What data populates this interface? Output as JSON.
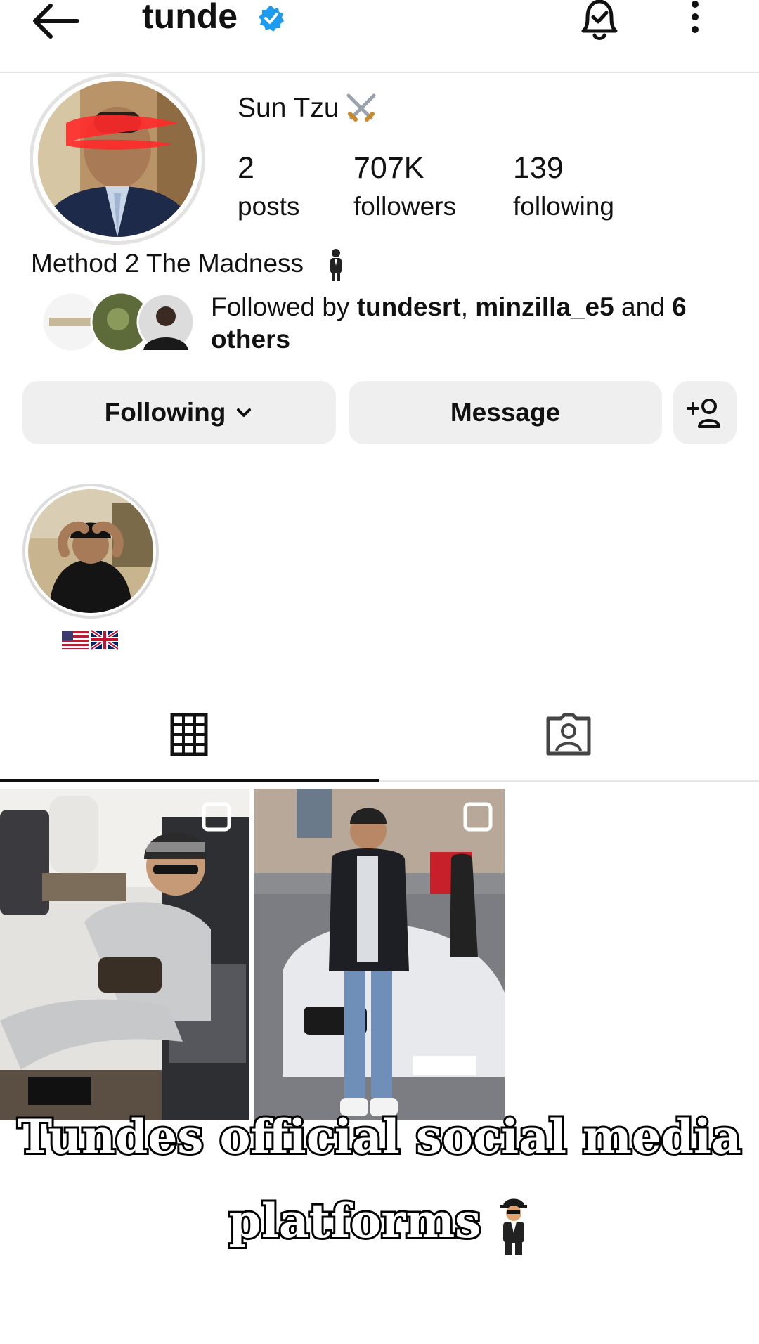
{
  "header": {
    "username": "tunde",
    "icons": [
      "back-arrow-icon",
      "verified-badge-icon",
      "notification-bell-icon",
      "more-options-icon"
    ]
  },
  "profile": {
    "display_name": "Sun Tzu",
    "stats": [
      {
        "value": "2",
        "label": "posts"
      },
      {
        "value": "707K",
        "label": "followers"
      },
      {
        "value": "139",
        "label": "following"
      }
    ],
    "bio": "Method 2 The Madness",
    "followed_by": {
      "prefix": "Followed by ",
      "user1": "tundesrt",
      "sep": ", ",
      "user2": "minzilla_e5",
      "and": " and ",
      "others": "6 others"
    }
  },
  "actions": {
    "following_label": "Following",
    "message_label": "Message"
  },
  "tabs": [
    "grid-icon",
    "tagged-icon"
  ],
  "overlay": {
    "line1": "Tundes official social media",
    "line2": "platforms"
  },
  "colors": {
    "verified": "#1d9bf0",
    "button_bg": "#efefef",
    "divider": "#e6e6e6"
  }
}
